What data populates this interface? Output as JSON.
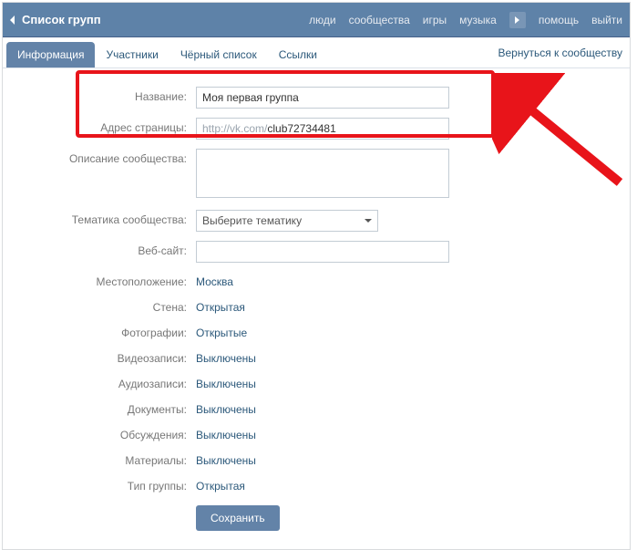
{
  "topbar": {
    "title": "Список групп",
    "nav": {
      "people": "люди",
      "communities": "сообщества",
      "games": "игры",
      "music": "музыка",
      "help": "помощь",
      "logout": "выйти"
    }
  },
  "tabs": {
    "info": "Информация",
    "members": "Участники",
    "blacklist": "Чёрный список",
    "links": "Ссылки",
    "backToCommunity": "Вернуться к сообществу"
  },
  "labels": {
    "name": "Название:",
    "pageAddress": "Адрес страницы:",
    "description": "Описание сообщества:",
    "subject": "Тематика сообщества:",
    "website": "Веб-сайт:",
    "location": "Местоположение:",
    "wall": "Стена:",
    "photos": "Фотографии:",
    "videos": "Видеозаписи:",
    "audios": "Аудиозаписи:",
    "docs": "Документы:",
    "discussions": "Обсуждения:",
    "materials": "Материалы:",
    "groupType": "Тип группы:"
  },
  "values": {
    "name": "Моя первая группа",
    "addrPrefix": "http://vk.com/",
    "addrSuffix": "club72734481",
    "subjectPlaceholder": "Выберите тематику",
    "website": "",
    "location": "Москва",
    "wall": "Открытая",
    "photos": "Открытые",
    "videos": "Выключены",
    "audios": "Выключены",
    "docs": "Выключены",
    "discussions": "Выключены",
    "materials": "Выключены",
    "groupType": "Открытая"
  },
  "buttons": {
    "save": "Сохранить"
  },
  "colors": {
    "brand": "#5e82a8",
    "link": "#2b587a",
    "highlight": "#e8141a"
  }
}
